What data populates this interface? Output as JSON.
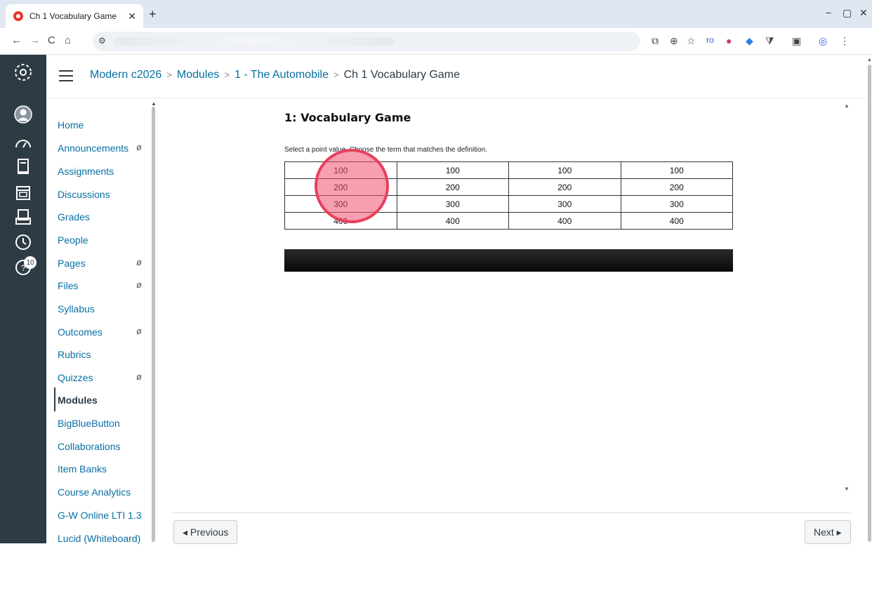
{
  "browser": {
    "tab_title": "Ch 1 Vocabulary Game",
    "tab_close": "✕",
    "new_tab": "+",
    "window_controls": [
      "−",
      "▢",
      "✕"
    ],
    "nav": [
      "←",
      "→",
      "C",
      "⌂"
    ],
    "site_info_icon": "⚙",
    "toolbar_icons": [
      "⧉",
      "⊕",
      "☆",
      "ro",
      "●",
      "◆",
      "⧩",
      "▣",
      "◎",
      "⋮"
    ]
  },
  "breadcrumb": {
    "course": "Modern c2026",
    "modules": "Modules",
    "module": "1 - The Automobile",
    "page": "Ch 1 Vocabulary Game",
    "separator": ">"
  },
  "global_nav": {
    "badge_count": "10",
    "collapse": "→|"
  },
  "course_nav": {
    "items": [
      {
        "label": "Home",
        "hidden": false
      },
      {
        "label": "Announcements",
        "hidden": true
      },
      {
        "label": "Assignments",
        "hidden": false
      },
      {
        "label": "Discussions",
        "hidden": false
      },
      {
        "label": "Grades",
        "hidden": false
      },
      {
        "label": "People",
        "hidden": false
      },
      {
        "label": "Pages",
        "hidden": true
      },
      {
        "label": "Files",
        "hidden": true
      },
      {
        "label": "Syllabus",
        "hidden": false
      },
      {
        "label": "Outcomes",
        "hidden": true
      },
      {
        "label": "Rubrics",
        "hidden": false
      },
      {
        "label": "Quizzes",
        "hidden": true
      },
      {
        "label": "Modules",
        "hidden": false,
        "active": true
      },
      {
        "label": "BigBlueButton",
        "hidden": false
      },
      {
        "label": "Collaborations",
        "hidden": false
      },
      {
        "label": "Item Banks",
        "hidden": false
      },
      {
        "label": "Course Analytics",
        "hidden": false
      },
      {
        "label": "G-W Online LTI 1.3",
        "hidden": false
      },
      {
        "label": "Lucid (Whiteboard)",
        "hidden": false
      }
    ],
    "hidden_icon": "ø"
  },
  "game": {
    "title": "1: Vocabulary Game",
    "instructions": "Select a point value. Choose the term that matches the definition.",
    "rows": [
      [
        "100",
        "100",
        "100",
        "100"
      ],
      [
        "200",
        "200",
        "200",
        "200"
      ],
      [
        "300",
        "300",
        "300",
        "300"
      ],
      [
        "400",
        "400",
        "400",
        "400"
      ]
    ]
  },
  "footer": {
    "previous": "◂ Previous",
    "next": "Next ▸"
  }
}
